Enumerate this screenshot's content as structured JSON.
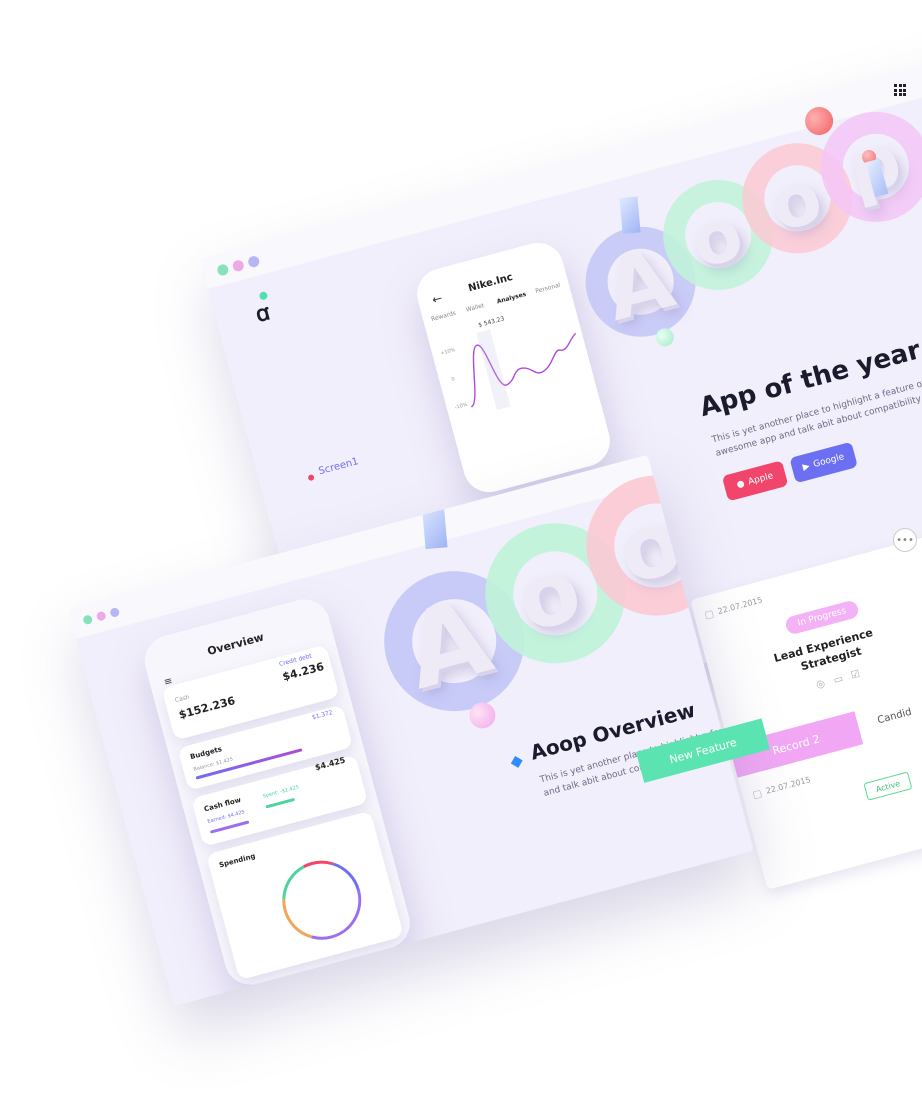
{
  "back_window": {
    "app_logo": "ꭤ",
    "screen_label": "Screen1",
    "hero_letters": [
      "A",
      "o",
      "o",
      "p"
    ],
    "title": "App of the year",
    "subtitle_line1": "This is yet another place to highlight a feature of your",
    "subtitle_line2": "awesome app and talk abit about compatibility maybe?",
    "apple_button": "Apple",
    "google_button": "Google",
    "phone": {
      "title": "Nike.Inc",
      "tabs": [
        "Rewards",
        "Wallet",
        "Analyses",
        "Personal"
      ],
      "amount": "$ 543.23",
      "y_labels": [
        "+10%",
        "0",
        "-10%"
      ]
    }
  },
  "front_window": {
    "hero_letters": [
      "A",
      "o",
      "o"
    ],
    "title": "Aoop Overview",
    "subtitle_line1": "This is yet another place to highlight a featu",
    "subtitle_line2": "and talk abit about compatibility maybe?",
    "phone": {
      "title": "Overview",
      "cash_label": "Cash",
      "cash_value": "$152.236",
      "credit_label": "Credit debt",
      "credit_value": "$4.236",
      "budgets_label": "Budgets",
      "budgets_value": "$1.372",
      "budgets_sub": "Balance: $1,425",
      "cashflow_label": "Cash flow",
      "cashflow_value": "$4.425",
      "earned": "Earned: $4,425",
      "spent": "Spent: -$2,425",
      "spending_label": "Spending"
    }
  },
  "side_card": {
    "date1": "22.07.2015",
    "status": "In Progress",
    "role_line1": "Lead Experience",
    "role_line2": "Strategist",
    "candidate_tab": "Candid",
    "record_label": "Record  2",
    "date2": "22.07.2015",
    "active_badge": "Active"
  },
  "new_feature_label": "New Feature",
  "colors": {
    "purple_ring": "#c3c6f7",
    "green_ring": "#bff3d8",
    "pink_ring": "#fbc9d3",
    "magenta_ring": "#f3c6f6",
    "apple_btn": "#f2456b",
    "google_btn": "#6d6ff2",
    "new_feature": "#5be3b1",
    "record": "#f1a7f4"
  }
}
